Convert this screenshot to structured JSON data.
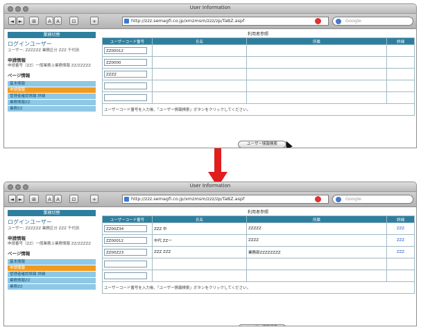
{
  "window_title": "User Information",
  "url": "http://zzz.semagfi.co.jp/xmzmsm/zzz/zp/TaBZ.aspf",
  "search_placeholder": "Google",
  "toolbar": [
    "◄",
    "►",
    "⊞",
    "A",
    "A",
    "⊡",
    "+"
  ],
  "sidebar": {
    "header": "業務切替",
    "login_title": "ログインユーザー",
    "login_info": "ユーザー: ZZZZZZ 業務区分 ZZZ 千代田",
    "dept_title": "申請情報",
    "dept_info": "申請番号（ZZ）一般業務上業務情報 ZZ/ZZZZZ",
    "page_title": "ページ情報",
    "menu": [
      "基本情報",
      "申請情報",
      "管理者確認情報 詳細",
      "業務情報ZZ",
      "業務ZZ"
    ],
    "active_index": 1
  },
  "main_title": "利用者参照",
  "columns": [
    "ユーザーコード番号",
    "氏名",
    "所属",
    "詳細"
  ],
  "before": {
    "rows": [
      {
        "code": "ZZ00012",
        "name": "",
        "org": "",
        "detail": ""
      },
      {
        "code": "ZZ0000",
        "name": "",
        "org": "",
        "detail": ""
      },
      {
        "code": "ZZZZ",
        "name": "",
        "org": "",
        "detail": ""
      },
      {
        "code": "",
        "name": "",
        "org": "",
        "detail": ""
      },
      {
        "code": "",
        "name": "",
        "org": "",
        "detail": ""
      }
    ]
  },
  "after": {
    "rows": [
      {
        "code": "ZZ00Z34",
        "name": "ZZZ 中",
        "org": "ZZZZZ",
        "detail": "ZZZ"
      },
      {
        "code": "ZZ00012",
        "name": "中代 ZZ一",
        "org": "ZZZZ",
        "detail": "ZZZ"
      },
      {
        "code": "ZZ00Z23",
        "name": "ZZZ ZZZ",
        "org": "業務部ZZZZZZZZ",
        "detail": "ZZZ"
      },
      {
        "code": "",
        "name": "",
        "org": "",
        "detail": ""
      },
      {
        "code": "",
        "name": "",
        "org": "",
        "detail": ""
      }
    ]
  },
  "note": "ユーザーコード番号を入力後、「ユーザー情報検索」ボタンをクリックしてください。",
  "search_button": "ユーザー情報検索",
  "colors": {
    "header": "#2d7f9e",
    "active_menu": "#f29a1f",
    "menu": "#8ec8e6",
    "arrow": "#e01e1e"
  }
}
